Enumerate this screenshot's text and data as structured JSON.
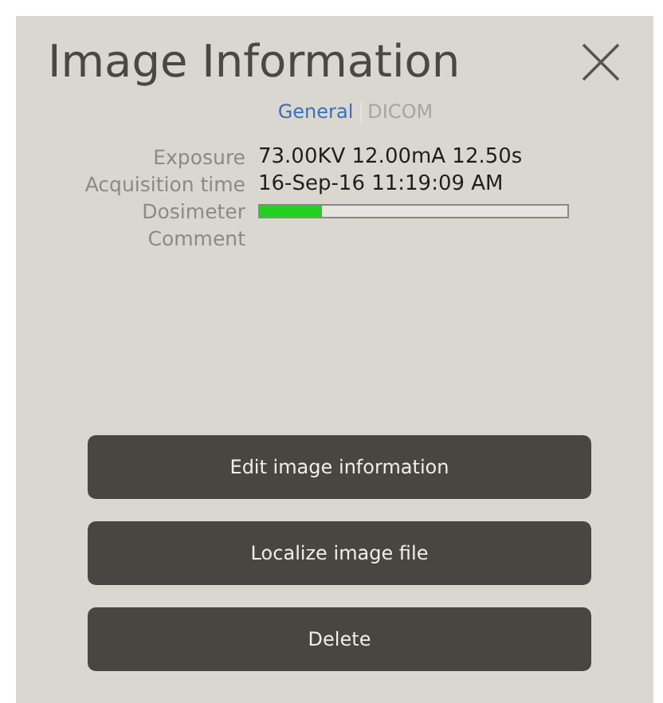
{
  "panel": {
    "title": "Image Information"
  },
  "tabs": [
    {
      "label": "General",
      "selected": true
    },
    {
      "label": "DICOM",
      "selected": false
    }
  ],
  "fields": [
    {
      "kind": "text",
      "label": "Exposure",
      "value": "73.00KV 12.00mA 12.50s"
    },
    {
      "kind": "text",
      "label": "Acquisition time",
      "value": "16-Sep-16 11:19:09 AM"
    },
    {
      "kind": "meter",
      "label": "Dosimeter",
      "level": 0.2
    },
    {
      "kind": "text",
      "label": "Comment"
    }
  ],
  "buttons": [
    "Edit image information",
    "Localize image file",
    "Delete"
  ]
}
